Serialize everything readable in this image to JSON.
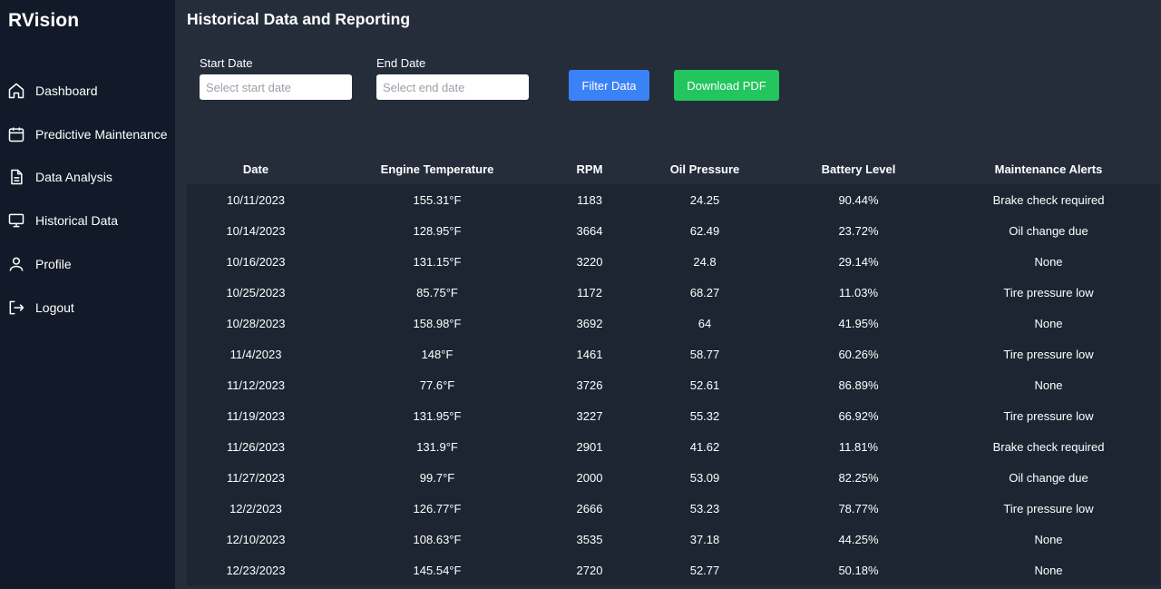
{
  "brand": "RVision",
  "sidebar": {
    "items": [
      {
        "label": "Dashboard",
        "icon": "home-icon"
      },
      {
        "label": "Predictive Maintenance",
        "icon": "calendar-icon"
      },
      {
        "label": "Data Analysis",
        "icon": "document-icon"
      },
      {
        "label": "Historical Data",
        "icon": "monitor-icon"
      },
      {
        "label": "Profile",
        "icon": "user-icon"
      },
      {
        "label": "Logout",
        "icon": "logout-icon"
      }
    ]
  },
  "page": {
    "title": "Historical Data and Reporting"
  },
  "filters": {
    "start_label": "Start Date",
    "start_placeholder": "Select start date",
    "end_label": "End Date",
    "end_placeholder": "Select end date",
    "filter_button": "Filter Data",
    "download_button": "Download PDF"
  },
  "colors": {
    "sidebar_bg": "#121a29",
    "main_bg": "#252d3b",
    "filter_button": "#3b82f6",
    "download_button": "#22c55e"
  },
  "table": {
    "headers": [
      "Date",
      "Engine Temperature",
      "RPM",
      "Oil Pressure",
      "Battery Level",
      "Maintenance Alerts"
    ],
    "rows": [
      [
        "10/11/2023",
        "155.31°F",
        "1183",
        "24.25",
        "90.44%",
        "Brake check required"
      ],
      [
        "10/14/2023",
        "128.95°F",
        "3664",
        "62.49",
        "23.72%",
        "Oil change due"
      ],
      [
        "10/16/2023",
        "131.15°F",
        "3220",
        "24.8",
        "29.14%",
        "None"
      ],
      [
        "10/25/2023",
        "85.75°F",
        "1172",
        "68.27",
        "11.03%",
        "Tire pressure low"
      ],
      [
        "10/28/2023",
        "158.98°F",
        "3692",
        "64",
        "41.95%",
        "None"
      ],
      [
        "11/4/2023",
        "148°F",
        "1461",
        "58.77",
        "60.26%",
        "Tire pressure low"
      ],
      [
        "11/12/2023",
        "77.6°F",
        "3726",
        "52.61",
        "86.89%",
        "None"
      ],
      [
        "11/19/2023",
        "131.95°F",
        "3227",
        "55.32",
        "66.92%",
        "Tire pressure low"
      ],
      [
        "11/26/2023",
        "131.9°F",
        "2901",
        "41.62",
        "11.81%",
        "Brake check required"
      ],
      [
        "11/27/2023",
        "99.7°F",
        "2000",
        "53.09",
        "82.25%",
        "Oil change due"
      ],
      [
        "12/2/2023",
        "126.77°F",
        "2666",
        "53.23",
        "78.77%",
        "Tire pressure low"
      ],
      [
        "12/10/2023",
        "108.63°F",
        "3535",
        "37.18",
        "44.25%",
        "None"
      ],
      [
        "12/23/2023",
        "145.54°F",
        "2720",
        "52.77",
        "50.18%",
        "None"
      ]
    ]
  }
}
